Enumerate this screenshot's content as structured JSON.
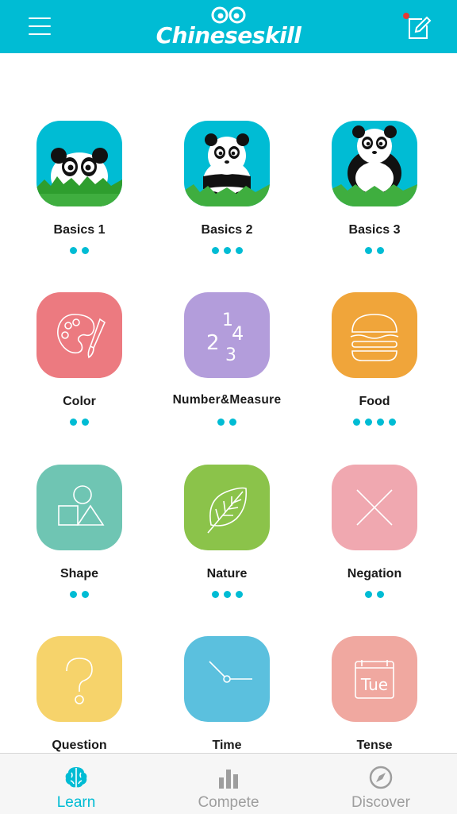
{
  "header": {
    "app_name": "Chineseskill",
    "menu_icon": "hamburger-menu-icon",
    "edit_icon": "edit-note-icon",
    "brand_color": "#00bcd4",
    "notification_dot_color": "#e53935"
  },
  "lessons": [
    {
      "label": "Basics 1",
      "dots": 2,
      "color": "#00bcd4",
      "icon": "panda-peek-icon"
    },
    {
      "label": "Basics 2",
      "dots": 3,
      "color": "#00bcd4",
      "icon": "panda-sitting-icon"
    },
    {
      "label": "Basics 3",
      "dots": 2,
      "color": "#00bcd4",
      "icon": "panda-standing-icon"
    },
    {
      "label": "Color",
      "dots": 2,
      "color": "#ec7a80",
      "icon": "palette-brush-icon"
    },
    {
      "label": "Number&Measure",
      "dots": 2,
      "color": "#b39ddb",
      "icon": "numbers-icon"
    },
    {
      "label": "Food",
      "dots": 4,
      "color": "#f0a53a",
      "icon": "burger-icon"
    },
    {
      "label": "Shape",
      "dots": 2,
      "color": "#6fc5b3",
      "icon": "shapes-icon"
    },
    {
      "label": "Nature",
      "dots": 3,
      "color": "#8bc34a",
      "icon": "leaf-icon"
    },
    {
      "label": "Negation",
      "dots": 2,
      "color": "#f0a8b0",
      "icon": "cross-icon"
    },
    {
      "label": "Question",
      "dots": 0,
      "color": "#f6d36b",
      "icon": "question-mark-icon"
    },
    {
      "label": "Time",
      "dots": 0,
      "color": "#5bc0de",
      "icon": "clock-icon"
    },
    {
      "label": "Tense",
      "dots": 0,
      "color": "#f0a8a0",
      "icon": "calendar-tue-icon"
    }
  ],
  "tense_icon_text": "Tue",
  "number_icon_text": [
    "2",
    "1",
    "4",
    "3"
  ],
  "tabs": [
    {
      "label": "Learn",
      "icon": "brain-icon",
      "active": true
    },
    {
      "label": "Compete",
      "icon": "bar-chart-icon",
      "active": false
    },
    {
      "label": "Discover",
      "icon": "compass-icon",
      "active": false
    }
  ],
  "active_tab_color": "#00bcd4",
  "inactive_tab_color": "#9e9e9e"
}
